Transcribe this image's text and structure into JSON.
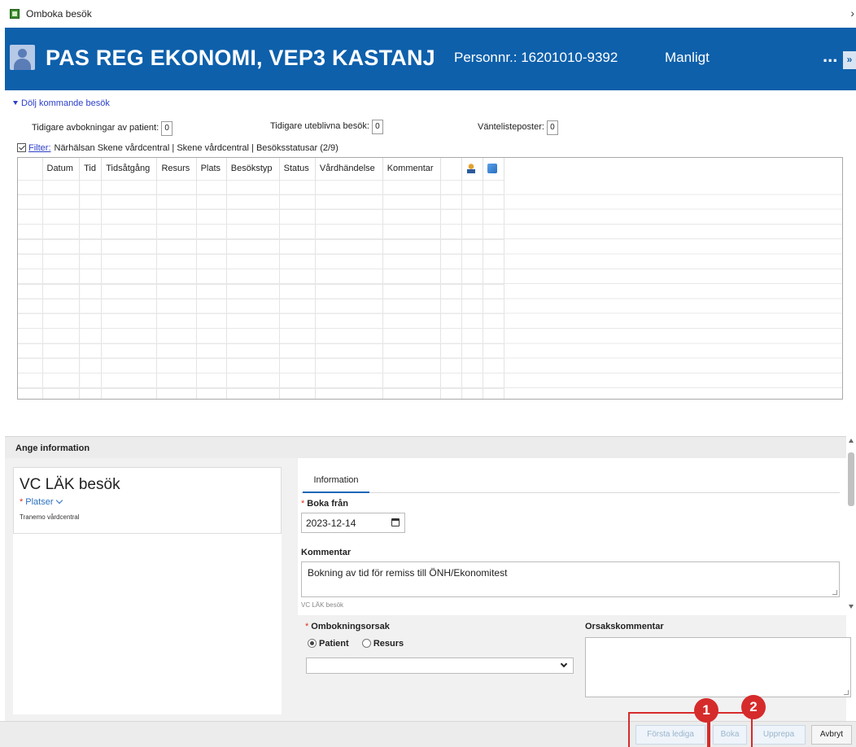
{
  "window": {
    "title": "Omboka besök",
    "close_glyph": "›"
  },
  "patient": {
    "name": "PAS REG EKONOMI, VEP3 KASTANJ",
    "personnr": "Personnr.: 16201010-9392",
    "gender": "Manligt",
    "more_label": "...",
    "expand_label": "»"
  },
  "upcoming": {
    "toggle_label": "Dölj kommande besök",
    "prior_cancellations_label": "Tidigare avbokningar av patient:",
    "prior_cancellations_value": "0",
    "prior_noshows_label": "Tidigare uteblivna besök:",
    "prior_noshows_value": "0",
    "waitlist_label": "Väntelisteposter:",
    "waitlist_value": "0",
    "filter_link": "Filter:",
    "filter_text": "Närhälsan Skene vårdcentral | Skene vårdcentral | Besöksstatusar (2/9)",
    "columns": [
      "Datum",
      "Tid",
      "Tidsåtgång",
      "Resurs",
      "Plats",
      "Besökstyp",
      "Status",
      "Vårdhändelse",
      "Kommentar"
    ]
  },
  "info": {
    "section_title": "Ange information",
    "visit_type": "VC LÄK besök",
    "places_label": "Platser",
    "place_value": "Tranemo vårdcentral",
    "tab_information": "Information",
    "book_from_label": "Boka från",
    "book_from_value": "2023-12-14",
    "comment_label": "Kommentar",
    "comment_value": "Bokning av tid för remiss till ÖNH/Ekonomitest",
    "hint": "VC LÄK besök",
    "rebook_reason_label": "Ombokningsorsak",
    "reason_patient": "Patient",
    "reason_resource": "Resurs",
    "reason_comment_label": "Orsakskommentar"
  },
  "footer": {
    "first_free": "Första lediga",
    "book": "Boka",
    "repeat": "Upprepa",
    "cancel": "Avbryt",
    "badge1": "1",
    "badge2": "2"
  },
  "colors": {
    "banner": "#0e60ab",
    "link": "#2b3fc8",
    "callout": "#d62b2b"
  }
}
